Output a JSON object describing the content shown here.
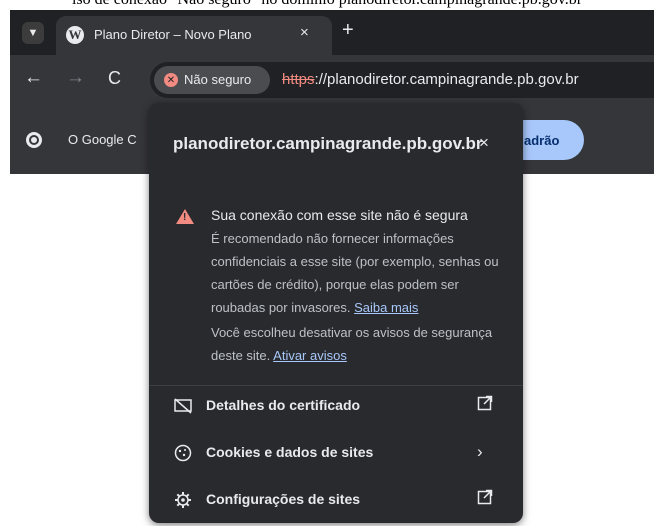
{
  "caption": "iso de conexão \"Não seguro\" no domínio planodiretor.campinagrande.pb.gov.br",
  "tabs": {
    "search_icon": "chevron-down-icon",
    "items": [
      {
        "title": "Plano Diretor – Novo Plano",
        "favicon": "wordpress-icon",
        "active": true
      }
    ],
    "close_glyph": "×",
    "newtab_glyph": "+"
  },
  "toolbar": {
    "back_glyph": "←",
    "forward_glyph": "→",
    "reload_glyph": "C",
    "security_label": "Não seguro",
    "url_protocol": "https",
    "url_rest": "://planodiretor.campinagrande.pb.gov.br"
  },
  "bookmarks": {
    "label": "O Google C",
    "button_label": "adrão"
  },
  "popup": {
    "title": "planodiretor.campinagrande.pb.gov.br",
    "close_glyph": "×",
    "warning_heading": "Sua conexão com esse site não é segura",
    "warning_body": "É recomendado não fornecer informações confidenciais a esse site (por exemplo, senhas ou cartões de crédito), porque elas podem ser roubadas por invasores. ",
    "learn_more": "Saiba mais",
    "disabled_text": "Você escolheu desativar os avisos de segurança deste site. ",
    "enable_warnings": "Ativar avisos",
    "rows": [
      {
        "label": "Detalhes do certificado",
        "icon": "certificate-icon",
        "trail": "external-link-icon"
      },
      {
        "label": "Cookies e dados de sites",
        "icon": "cookie-icon",
        "trail": "chevron-right-icon"
      },
      {
        "label": "Configurações de sites",
        "icon": "gear-icon",
        "trail": "external-link-icon"
      }
    ]
  },
  "colors": {
    "chrome_dark": "#202124",
    "toolbar": "#35363a",
    "popup": "#282a2d",
    "warning": "#f28b82",
    "link": "#a8c7fa"
  }
}
